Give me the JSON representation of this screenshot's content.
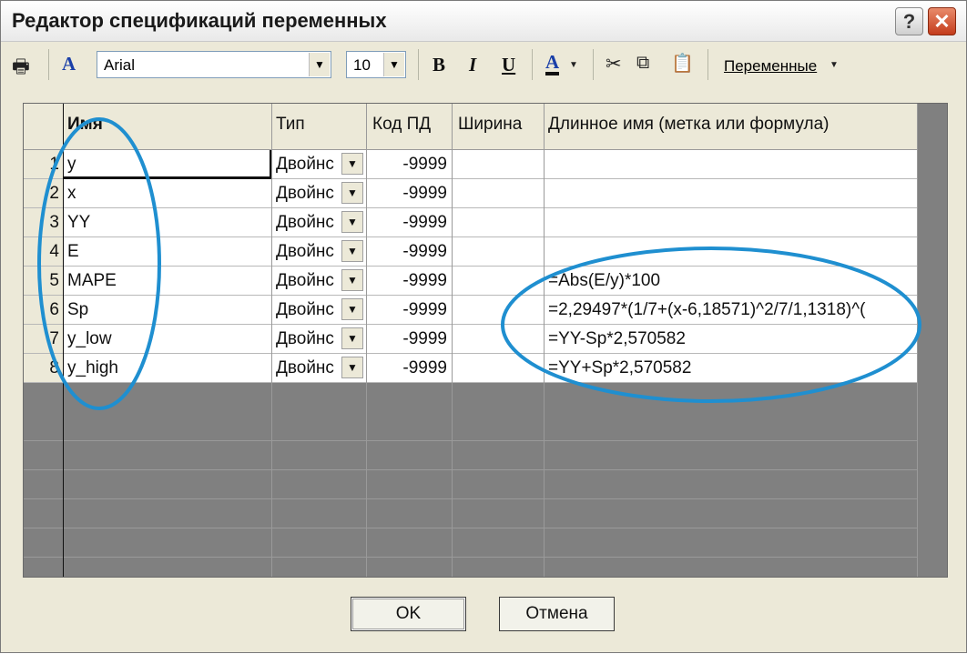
{
  "window": {
    "title": "Редактор спецификаций переменных"
  },
  "toolbar": {
    "font_name": "Arial",
    "font_size": "10",
    "bold": "B",
    "italic": "I",
    "underline": "U",
    "font_color": "A",
    "variables_menu": "Переменные"
  },
  "grid": {
    "headers": [
      "Имя",
      "Тип",
      "Код ПД",
      "Ширина",
      "Длинное имя (метка или формула)"
    ],
    "rows": [
      {
        "n": "1",
        "name": "y",
        "type": "Двойнс",
        "code": "-9999",
        "width": "",
        "long": ""
      },
      {
        "n": "2",
        "name": "x",
        "type": "Двойнс",
        "code": "-9999",
        "width": "",
        "long": ""
      },
      {
        "n": "3",
        "name": "YY",
        "type": "Двойнс",
        "code": "-9999",
        "width": "",
        "long": ""
      },
      {
        "n": "4",
        "name": "E",
        "type": "Двойнс",
        "code": "-9999",
        "width": "",
        "long": ""
      },
      {
        "n": "5",
        "name": "MAPE",
        "type": "Двойнс",
        "code": "-9999",
        "width": "",
        "long": "=Abs(E/y)*100"
      },
      {
        "n": "6",
        "name": "Sp",
        "type": "Двойнс",
        "code": "-9999",
        "width": "",
        "long": "=2,29497*(1/7+(x-6,18571)^2/7/1,1318)^("
      },
      {
        "n": "7",
        "name": "y_low",
        "type": "Двойнс",
        "code": "-9999",
        "width": "",
        "long": "=YY-Sp*2,570582"
      },
      {
        "n": "8",
        "name": "y_high",
        "type": "Двойнс",
        "code": "-9999",
        "width": "",
        "long": "=YY+Sp*2,570582"
      }
    ]
  },
  "buttons": {
    "ok": "OK",
    "cancel": "Отмена"
  },
  "annotations": {
    "color": "#1f8fd0"
  }
}
